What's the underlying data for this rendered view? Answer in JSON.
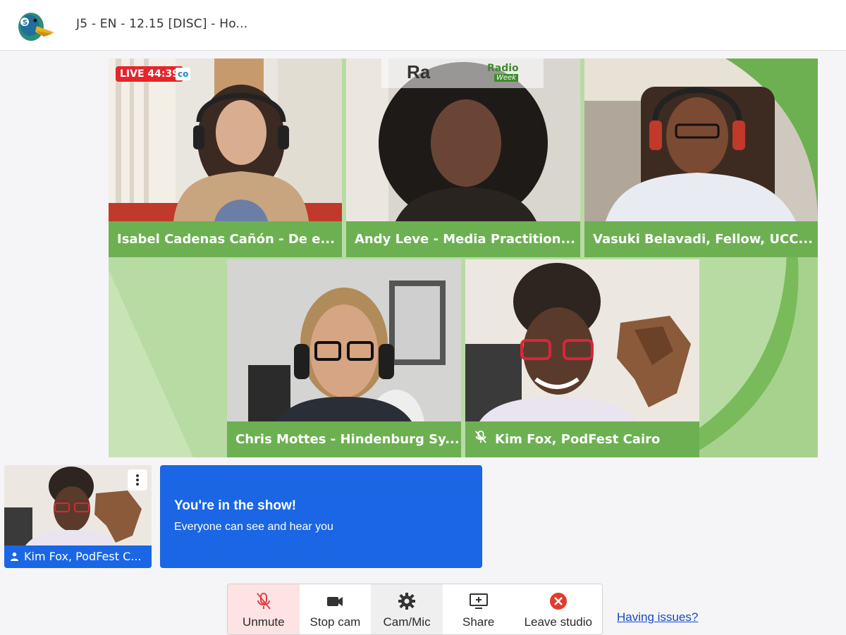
{
  "header": {
    "title": "J5 - EN - 12.15 [DISC] - Ho...",
    "logo_icon": "duck-logo-icon"
  },
  "stage": {
    "live_badge": "LIVE 44:39",
    "logo_tag_text": "co",
    "radio_week": {
      "fragment": "Ra",
      "radio": "Radio",
      "week": "Week"
    },
    "accent_color": "#6db052",
    "participants": [
      {
        "name": "Isabel Cadenas Cañón - De e...",
        "muted": false
      },
      {
        "name": "Andy Leve - Media Practition...",
        "muted": false
      },
      {
        "name": "Vasuki Belavadi, Fellow, UCC...",
        "muted": false
      },
      {
        "name": "Chris Mottes - Hindenburg Sy...",
        "muted": false
      },
      {
        "name": "Kim Fox, PodFest Cairo",
        "muted": true
      }
    ]
  },
  "self_preview": {
    "name": "Kim Fox, PodFest C...",
    "menu_icon": "more-vertical-icon"
  },
  "notice": {
    "heading": "You're in the show!",
    "subtext": "Everyone can see and hear you",
    "color": "#1a66e5"
  },
  "toolbar": {
    "buttons": [
      {
        "label": "Unmute",
        "icon": "mic-off-icon"
      },
      {
        "label": "Stop cam",
        "icon": "camera-icon"
      },
      {
        "label": "Cam/Mic",
        "icon": "gear-icon"
      },
      {
        "label": "Share",
        "icon": "screen-share-icon"
      },
      {
        "label": "Leave studio",
        "icon": "close-circle-icon"
      }
    ]
  },
  "help_link": "Having issues?"
}
